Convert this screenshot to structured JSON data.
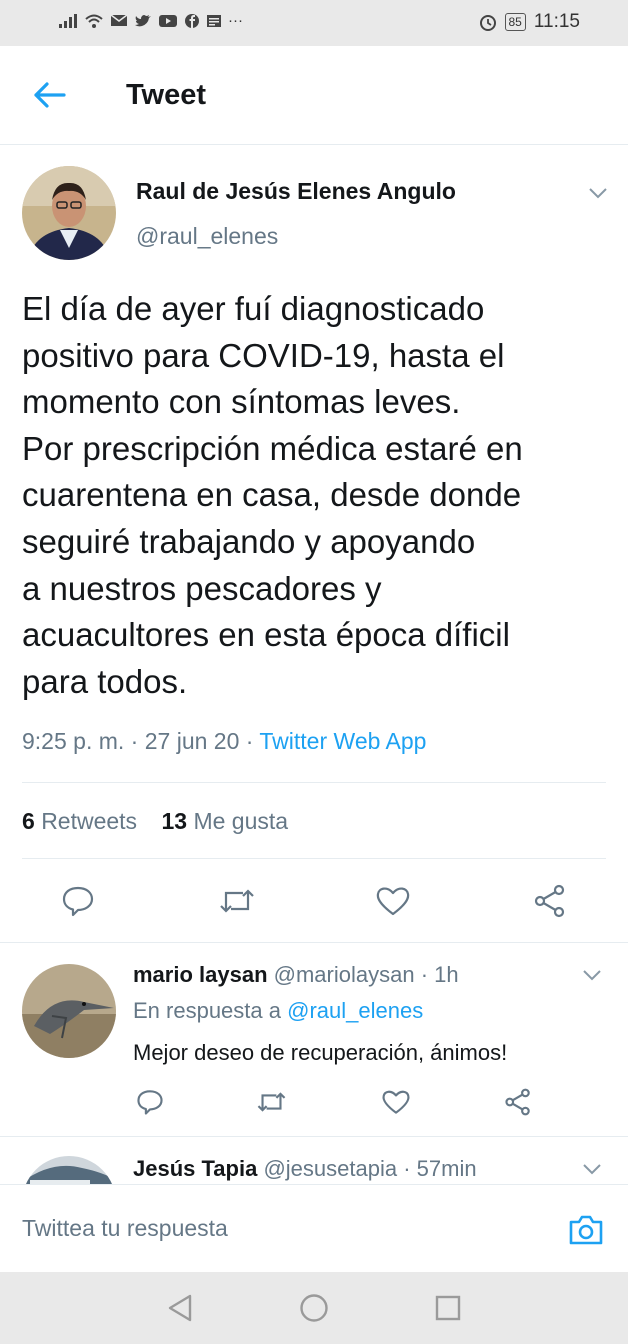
{
  "status_bar": {
    "left_icons": [
      "signal-icon",
      "wifi-icon",
      "mail-icon",
      "twitter-icon",
      "youtube-icon",
      "facebook-icon",
      "news-icon"
    ],
    "more": "···",
    "battery": "85",
    "time": "11:15"
  },
  "header": {
    "title": "Tweet"
  },
  "tweet": {
    "author_name": "Raul de Jesús Elenes Angulo",
    "handle": "@raul_elenes",
    "lines": [
      "El día de ayer fuí diagnosticado",
      "positivo para COVID-19, hasta el",
      "momento con síntomas leves.",
      "Por prescripción médica estaré en",
      "cuarentena en casa, desde donde",
      "seguiré trabajando y apoyando",
      "a nuestros pescadores y",
      "acuacultores en esta época díficil",
      "para todos."
    ],
    "time": "9:25 p. m.",
    "date": "27 jun 20",
    "separator": " · ",
    "app": "Twitter Web App",
    "retweets_count": "6",
    "retweets_label": "Retweets",
    "likes_count": "13",
    "likes_label": "Me gusta"
  },
  "replies": [
    {
      "name": "mario laysan",
      "handle": "@mariolaysan",
      "sep": " · ",
      "time": "1h",
      "reply_to_label": "En respuesta a",
      "reply_to": "@raul_elenes",
      "text": "Mejor deseo de recuperación, ánimos!"
    },
    {
      "name": "Jesús Tapia",
      "handle": "@jesusetapia",
      "sep": " · ",
      "time": "57min"
    }
  ],
  "composer": {
    "placeholder": "Twittea tu respuesta"
  },
  "colors": {
    "accent": "#1da1f2",
    "muted": "#657786",
    "text": "#14171a",
    "divider": "#e6ecf0",
    "status_bar": "#e9e9e9"
  }
}
